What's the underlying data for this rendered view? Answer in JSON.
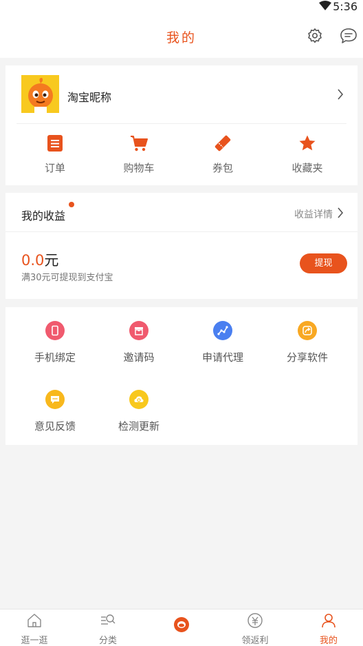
{
  "status_bar": {
    "time": "5:36"
  },
  "header": {
    "title": "我的"
  },
  "profile": {
    "nickname": "淘宝昵称"
  },
  "shortcuts": [
    {
      "label": "订单",
      "icon": "order-icon"
    },
    {
      "label": "购物车",
      "icon": "cart-icon"
    },
    {
      "label": "券包",
      "icon": "coupon-icon"
    },
    {
      "label": "收藏夹",
      "icon": "star-icon"
    }
  ],
  "earnings": {
    "title": "我的收益",
    "detail_link": "收益详情",
    "amount": "0.0",
    "unit": "元",
    "hint": "满30元可提现到支付宝",
    "withdraw_label": "提现"
  },
  "tools": [
    {
      "label": "手机绑定",
      "icon": "phone-icon",
      "color": "#f05a6e"
    },
    {
      "label": "邀请码",
      "icon": "invite-icon",
      "color": "#f05a6e"
    },
    {
      "label": "申请代理",
      "icon": "agent-icon",
      "color": "#4a7ff0"
    },
    {
      "label": "分享软件",
      "icon": "share-icon",
      "color": "#f8a823"
    },
    {
      "label": "意见反馈",
      "icon": "feedback-icon",
      "color": "#f8b81d"
    },
    {
      "label": "检测更新",
      "icon": "update-icon",
      "color": "#f8c81d"
    }
  ],
  "tabs": [
    {
      "label": "逛一逛",
      "icon": "home-icon"
    },
    {
      "label": "分类",
      "icon": "category-search-icon"
    },
    {
      "label": "",
      "icon": "center-logo-icon"
    },
    {
      "label": "领返利",
      "icon": "rebate-icon"
    },
    {
      "label": "我的",
      "icon": "user-icon",
      "active": true
    }
  ],
  "colors": {
    "accent": "#e8531d",
    "background": "#f4f4f4",
    "card": "#ffffff"
  }
}
